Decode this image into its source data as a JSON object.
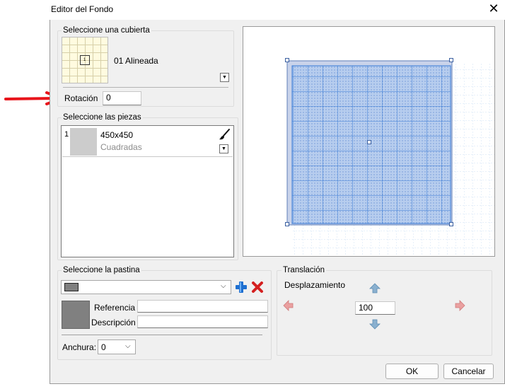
{
  "window": {
    "title": "Editor del Fondo",
    "close_glyph": "✕"
  },
  "cubierta": {
    "group_label": "Seleccione una cubierta",
    "name": "01 Alineada",
    "thumb_glyph": "1",
    "dropdown_glyph": "▼",
    "rotation_label": "Rotación",
    "rotation_value": "0"
  },
  "piezas": {
    "group_label": "Seleccione las piezas",
    "items": [
      {
        "index": "1",
        "size": "450x450",
        "type": "Cuadradas",
        "dropdown_glyph": "▼",
        "brush_icon": "brush-icon"
      }
    ]
  },
  "pastina": {
    "group_label": "Seleccione la pastina",
    "swatch_color": "#808080",
    "combo_chevron": "⌵",
    "referencia_label": "Referencia",
    "referencia_value": "",
    "descripcion_label": "Descripción",
    "descripcion_value": "",
    "anchura_label": "Anchura:",
    "anchura_value": "0"
  },
  "traslacion": {
    "group_label": "Translación",
    "desplazamiento_label": "Desplazamiento",
    "value": "100"
  },
  "buttons": {
    "ok": "OK",
    "cancel": "Cancelar"
  },
  "colors": {
    "accent_blue": "#3a7bd5",
    "annotation_red": "#e8141b",
    "add_blue": "#1e6fd0",
    "delete_red": "#d42020"
  }
}
